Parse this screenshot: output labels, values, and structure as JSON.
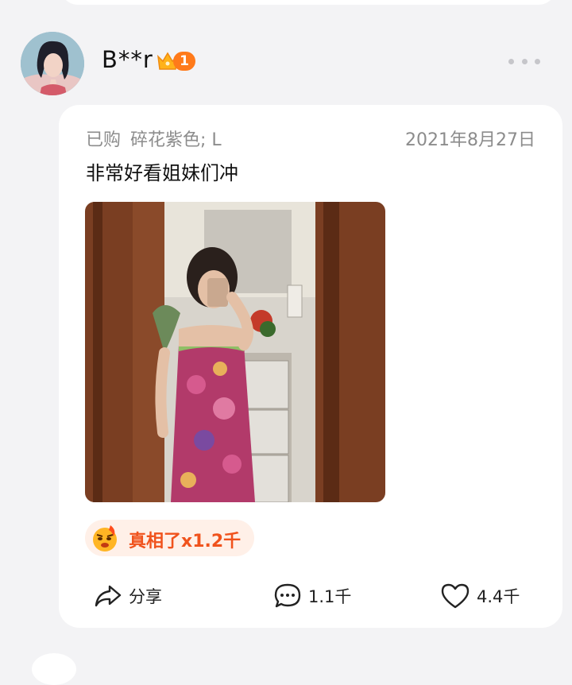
{
  "user": {
    "name": "B**r",
    "vip_level": "1",
    "avatar_icon": "avatar-illustration",
    "more_icon": "more-dots-icon"
  },
  "review": {
    "purchase_label": "已购",
    "spec": "碎花紫色; L",
    "date": "2021年8月27日",
    "text": "非常好看姐妹们冲",
    "photo_icon": "review-photo"
  },
  "reaction": {
    "icon": "emoji-fire-face-icon",
    "label": "真相了x1.2千"
  },
  "actions": {
    "share_label": "分享",
    "comment_count": "1.1千",
    "like_count": "4.4千"
  },
  "colors": {
    "accent_orange": "#f0521c",
    "vip_orange": "#ff7a1a",
    "reaction_bg": "#fff0e8",
    "page_bg": "#f3f3f5"
  }
}
